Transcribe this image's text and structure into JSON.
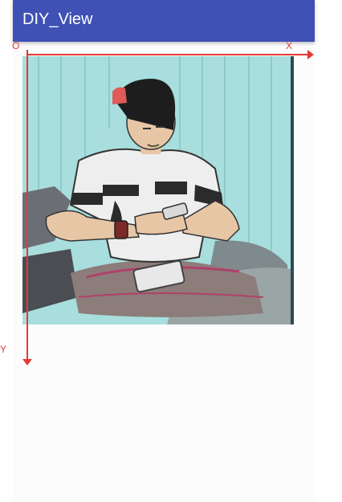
{
  "app": {
    "title": "DIY_View"
  },
  "axes": {
    "origin_label": "O",
    "x_label": "X",
    "y_label": "Y",
    "color": "#e53935"
  },
  "colors": {
    "appbar": "#3f51b5",
    "background": "#fafafa"
  }
}
